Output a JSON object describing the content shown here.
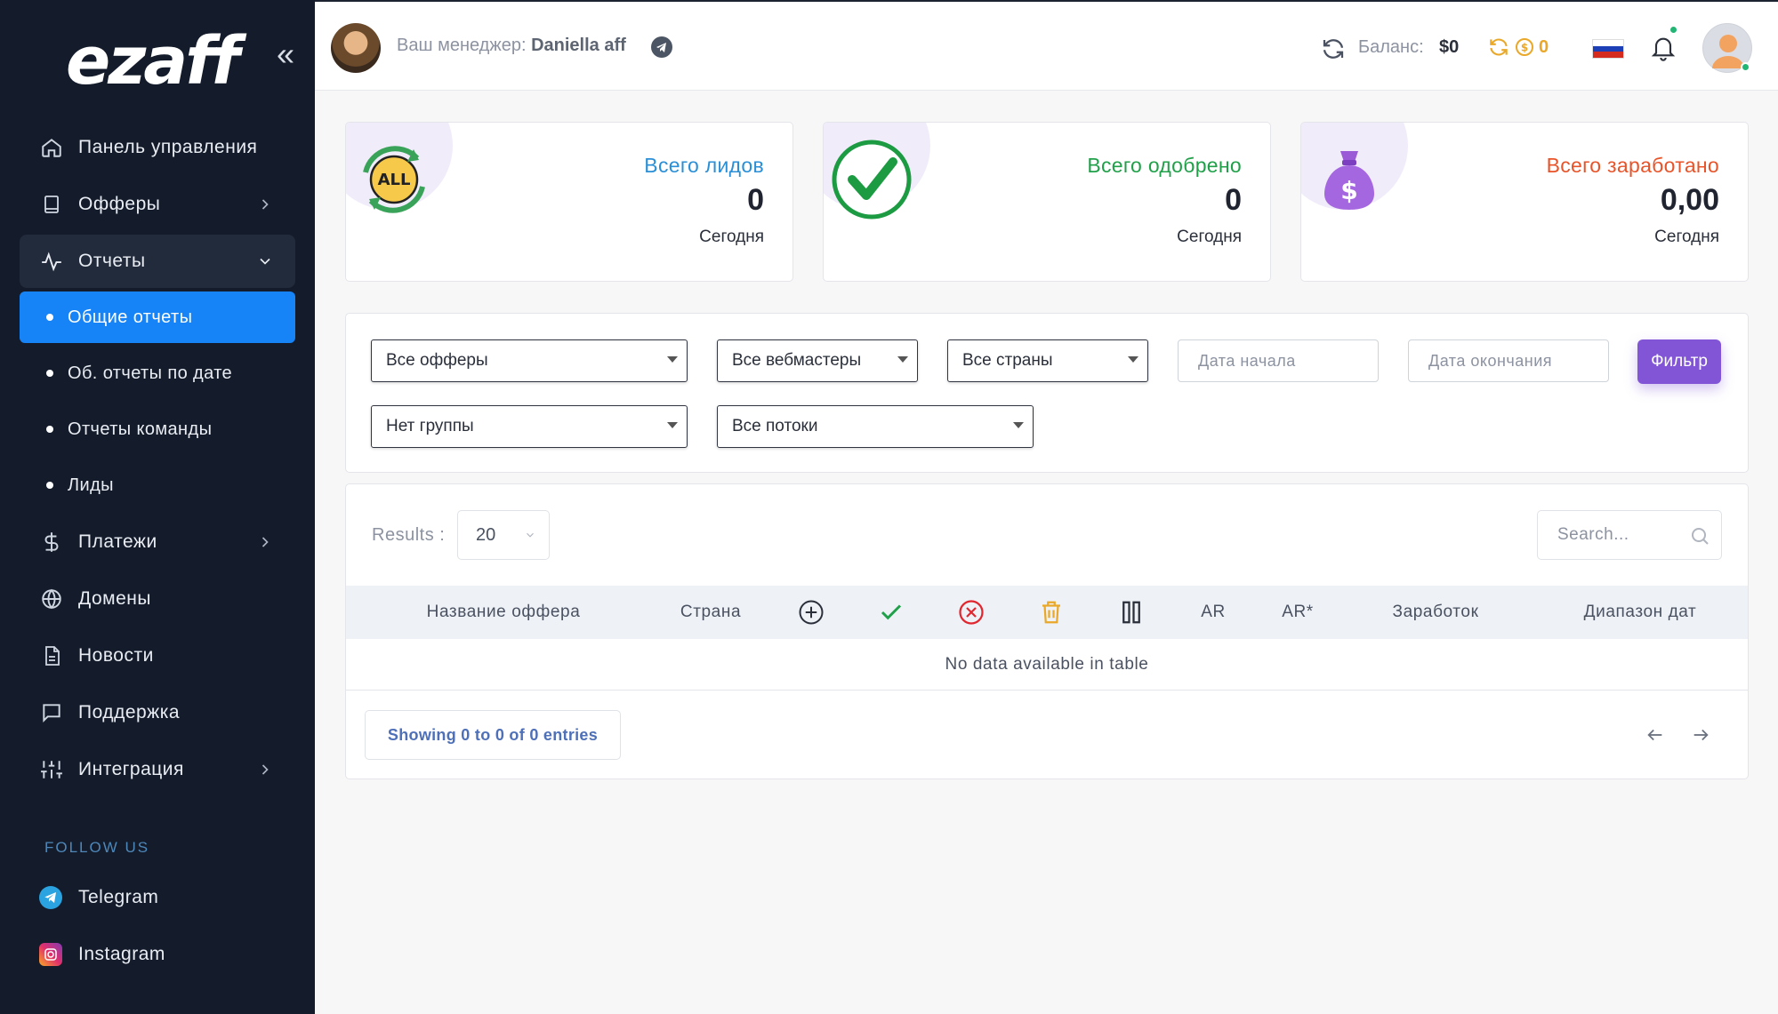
{
  "sidebar": {
    "logo": "ezaff",
    "collapse": "«",
    "items": [
      {
        "label": "Панель управления"
      },
      {
        "label": "Офферы"
      },
      {
        "label": "Отчеты"
      },
      {
        "label": "Платежи"
      },
      {
        "label": "Домены"
      },
      {
        "label": "Новости"
      },
      {
        "label": "Поддержка"
      },
      {
        "label": "Интеграция"
      }
    ],
    "reports_sub": [
      {
        "label": "Общие отчеты"
      },
      {
        "label": "Об. отчеты по дате"
      },
      {
        "label": "Отчеты команды"
      },
      {
        "label": "Лиды"
      }
    ],
    "follow_label": "FOLLOW US",
    "social": [
      {
        "label": "Telegram"
      },
      {
        "label": "Instagram"
      }
    ]
  },
  "topbar": {
    "manager_prefix": "Ваш менеджер:",
    "manager_name": "Daniella aff",
    "balance_label": "Баланс:",
    "balance_value": "$0",
    "coins_value": "0"
  },
  "stats": [
    {
      "title": "Всего лидов",
      "value": "0",
      "period": "Сегодня",
      "color": "#2a8fd6"
    },
    {
      "title": "Всего одобрено",
      "value": "0",
      "period": "Сегодня",
      "color": "#21a04a"
    },
    {
      "title": "Всего заработано",
      "value": "0,00",
      "period": "Сегодня",
      "color": "#e8542a"
    }
  ],
  "filters": {
    "offers": "Все офферы",
    "webmasters": "Все вебмастеры",
    "countries": "Все страны",
    "date_start": "Дата начала",
    "date_end": "Дата окончания",
    "filter_button": "Фильтр",
    "group": "Нет группы",
    "streams": "Все потоки"
  },
  "table": {
    "results_label": "Results :",
    "results_value": "20",
    "search_placeholder": "Search...",
    "columns": {
      "offer_name": "Название оффера",
      "country": "Страна",
      "ar": "AR",
      "ar_star": "AR*",
      "earnings": "Заработок",
      "date_range": "Диапазон дат"
    },
    "empty_text": "No data available in table",
    "entries_text": "Showing 0 to 0 of 0 entries"
  },
  "colors": {
    "sidebar_bg": "#141c2b",
    "active_blue": "#1683f6",
    "filter_purple": "#8155d6"
  }
}
